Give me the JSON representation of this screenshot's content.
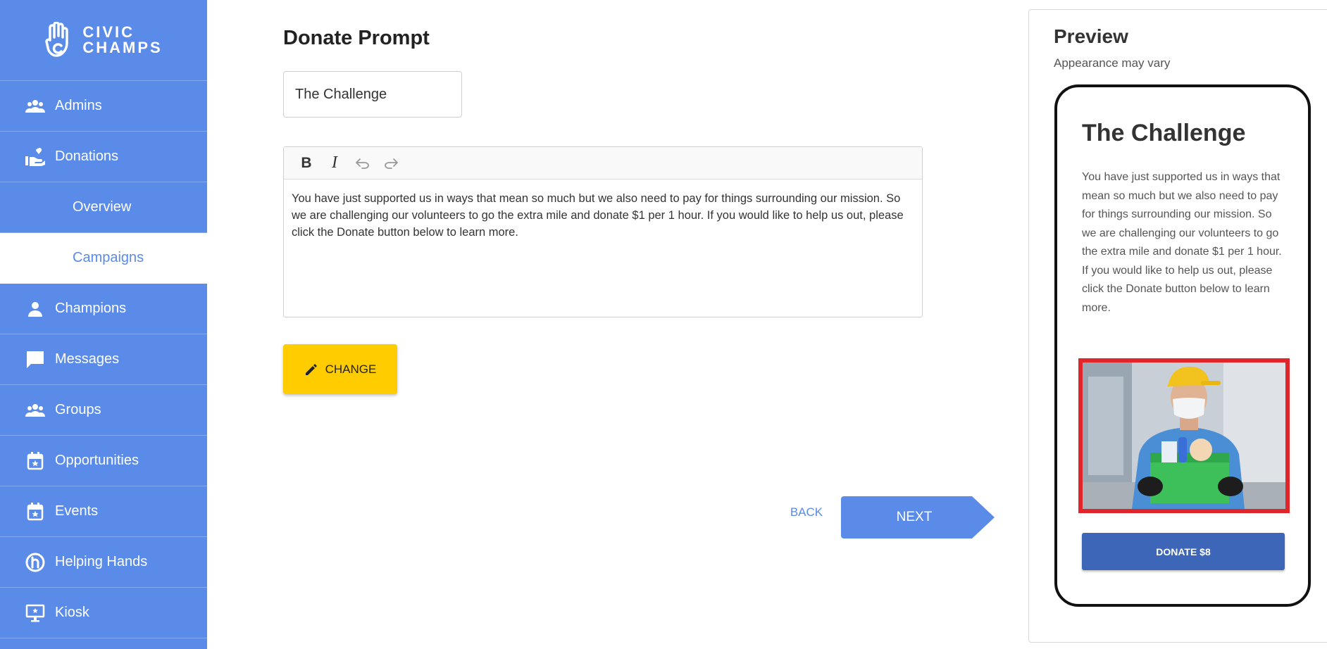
{
  "brand": {
    "line1": "CIVIC",
    "line2": "CHAMPS"
  },
  "sidebar": {
    "items": [
      {
        "label": "Admins",
        "icon": "people-icon"
      },
      {
        "label": "Donations",
        "icon": "donation-hand-icon"
      },
      {
        "label": "Overview",
        "icon": ""
      },
      {
        "label": "Campaigns",
        "icon": ""
      },
      {
        "label": "Champions",
        "icon": "person-icon"
      },
      {
        "label": "Messages",
        "icon": "chat-icon"
      },
      {
        "label": "Groups",
        "icon": "people-icon"
      },
      {
        "label": "Opportunities",
        "icon": "calendar-star-icon"
      },
      {
        "label": "Events",
        "icon": "calendar-star-icon"
      },
      {
        "label": "Helping Hands",
        "icon": "helping-hands-icon"
      },
      {
        "label": "Kiosk",
        "icon": "kiosk-icon"
      }
    ],
    "active": "Campaigns"
  },
  "form": {
    "heading": "Donate Prompt",
    "title_value": "The Challenge",
    "toolbar": {
      "bold": "B",
      "italic": "I"
    },
    "body_text": "You have just supported us in ways that mean so much but we also need to pay for things surrounding our mission. So we are challenging our volunteers to go the extra mile and donate $1 per 1 hour. If you would like to help us out, please click the Donate button below to learn more.",
    "change_label": "CHANGE",
    "back_label": "BACK",
    "next_label": "NEXT"
  },
  "preview": {
    "title": "Preview",
    "subtitle": "Appearance may vary",
    "heading": "The Challenge",
    "text": "You have just supported us in ways that mean so much but we also need to pay for things surrounding our mission. So we are challenging our volunteers to go the extra mile and donate $1 per 1 hour. If you would like to help us out, please click the Donate button below to learn more.",
    "donate_label": "DONATE $8"
  },
  "colors": {
    "sidebar": "#5b8be8",
    "accent_yellow": "#ffcc00",
    "donate_button": "#3d66b8",
    "image_border": "#e0262b"
  }
}
